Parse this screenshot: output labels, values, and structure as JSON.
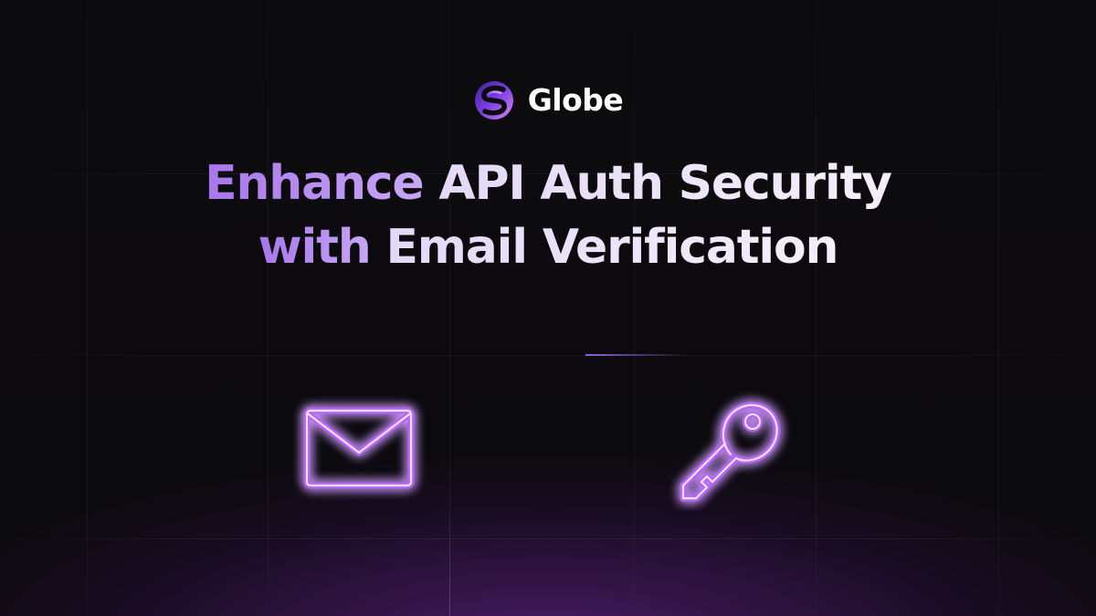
{
  "brand": {
    "name": "Globe",
    "logo_icon": "globe-s-logo-icon"
  },
  "headline": {
    "line1_accent": "Enhance",
    "line1_main": "API Auth Security",
    "line2_accent": "with",
    "line2_main": "Email Verification"
  },
  "icons": {
    "left": "envelope-icon",
    "right": "key-icon"
  },
  "colors": {
    "background": "#0b0a0d",
    "accent_purple": "#a776ec",
    "neon_purple": "#b964ff",
    "headline_light": "#ede4fa",
    "bottom_glow": "#7a28aa"
  }
}
